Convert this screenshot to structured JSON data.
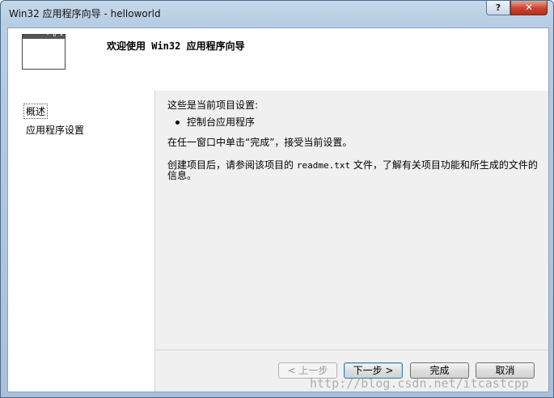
{
  "window": {
    "title": "Win32 应用程序向导 - helloworld",
    "help_label": "?",
    "close_label": "✕"
  },
  "header": {
    "title": "欢迎使用 Win32 应用程序向导",
    "icon": "window-icon"
  },
  "nav": {
    "items": [
      {
        "label": "概述",
        "selected": true
      },
      {
        "label": "应用程序设置",
        "selected": false
      }
    ]
  },
  "content": {
    "settings_heading": "这些是当前项目设置:",
    "bullets": [
      "控制台应用程序"
    ],
    "finish_hint": "在任一窗口中单击“完成”，接受当前设置。",
    "readme_prefix": "创建项目后，请参阅该项目的",
    "readme_file": "readme.txt",
    "readme_suffix": "文件，了解有关项目功能和所生成的文件的信息。"
  },
  "buttons": {
    "prev": "< 上一步",
    "next": "下一步 >",
    "finish": "完成",
    "cancel": "取消"
  },
  "watermark": "http://blog.csdn.net/itcastcpp"
}
